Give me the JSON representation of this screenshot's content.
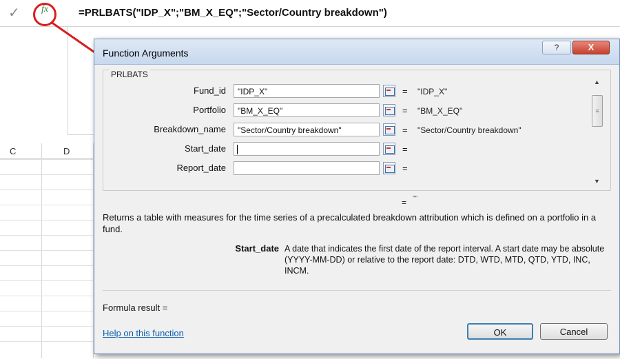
{
  "formula_bar": {
    "check_symbol": "✓",
    "fx_label": "fx",
    "formula": "=PRLBATS(\"IDP_X\";\"BM_X_EQ\";\"Sector/Country breakdown\")"
  },
  "sheet": {
    "columns": [
      "C",
      "D"
    ]
  },
  "dialog": {
    "title": "Function Arguments",
    "help_symbol": "?",
    "close_symbol": "X",
    "function_name": "PRLBATS",
    "args": [
      {
        "label": "Fund_id",
        "value": "\"IDP_X\"",
        "result": "\"IDP_X\""
      },
      {
        "label": "Portfolio",
        "value": "\"BM_X_EQ\"",
        "result": "\"BM_X_EQ\""
      },
      {
        "label": "Breakdown_name",
        "value": "\"Sector/Country breakdown\"",
        "result": "\"Sector/Country breakdown\""
      },
      {
        "label": "Start_date",
        "value": "",
        "result": ""
      },
      {
        "label": "Report_date",
        "value": "",
        "result": ""
      }
    ],
    "equals": "=",
    "function_result": "\"\"",
    "description": "Returns a table with measures for the time series of a precalculated breakdown attribution which is defined on a portfolio in a fund.",
    "arg_help_name": "Start_date",
    "arg_help_text": "A date that indicates the first date of the report interval. A start date may be absolute (YYYY-MM-DD) or relative to the report date: DTD, WTD, MTD, QTD, YTD, INC, INCM.",
    "formula_result_label": "Formula result =",
    "help_link": "Help on this function",
    "ok_label": "OK",
    "cancel_label": "Cancel"
  },
  "colors": {
    "highlight": "#d81e1e",
    "link": "#0b5fb0",
    "fx": "#2e8b3a"
  },
  "icons": {
    "scroll_up": "▲",
    "scroll_thumb": "≡",
    "scroll_down": "▼"
  }
}
